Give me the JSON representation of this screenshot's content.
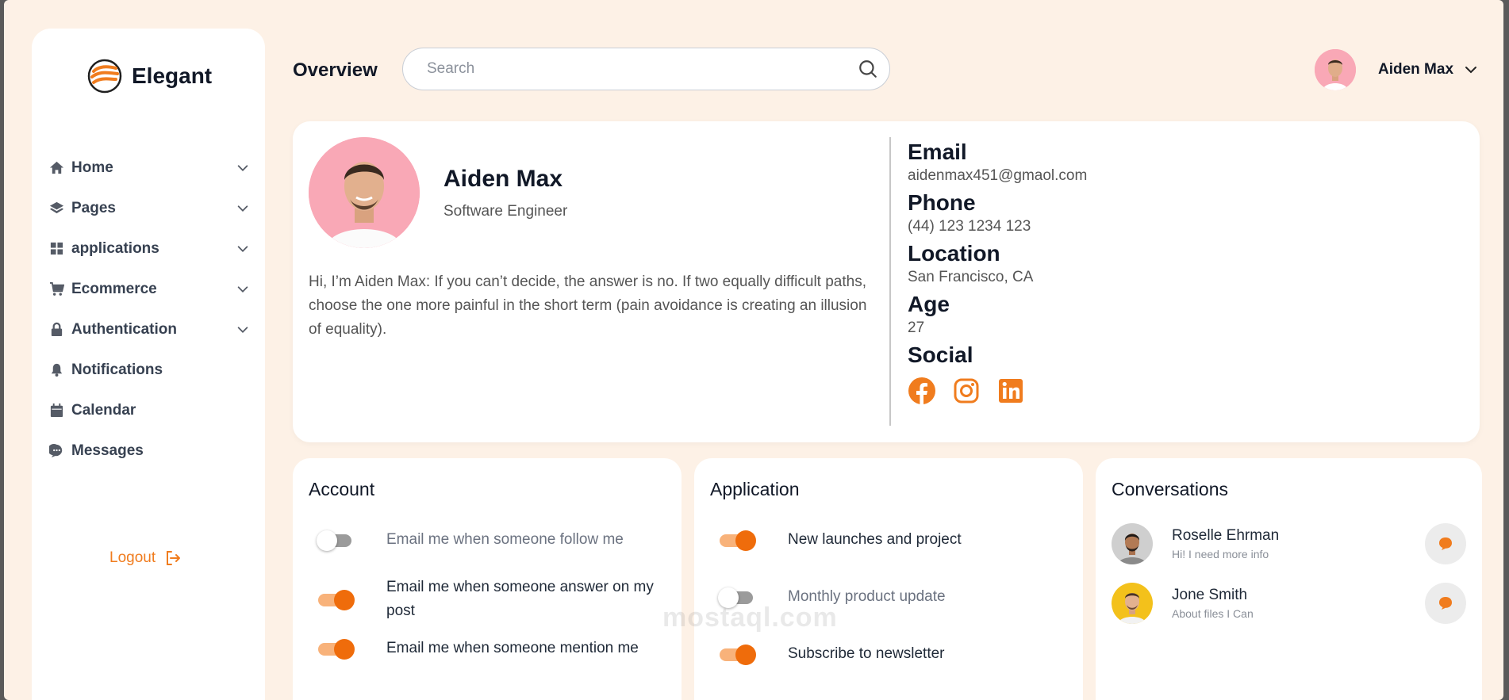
{
  "brand": {
    "name": "Elegant"
  },
  "sidebar": {
    "items": [
      {
        "label": "Home",
        "icon": "home-icon",
        "has_chevron": true
      },
      {
        "label": "Pages",
        "icon": "layers-icon",
        "has_chevron": true
      },
      {
        "label": "applications",
        "icon": "grid-icon",
        "has_chevron": true
      },
      {
        "label": "Ecommerce",
        "icon": "cart-icon",
        "has_chevron": true
      },
      {
        "label": "Authentication",
        "icon": "lock-icon",
        "has_chevron": true
      },
      {
        "label": "Notifications",
        "icon": "bell-icon",
        "has_chevron": false
      },
      {
        "label": "Calendar",
        "icon": "calendar-icon",
        "has_chevron": false
      },
      {
        "label": "Messages",
        "icon": "chat-icon",
        "has_chevron": false
      }
    ],
    "logout_label": "Logout"
  },
  "header": {
    "title": "Overview",
    "search_placeholder": "Search",
    "user_name": "Aiden Max"
  },
  "profile": {
    "name": "Aiden Max",
    "role": "Software Engineer",
    "bio": "Hi, I’m Aiden Max: If you can’t decide, the answer is no. If two equally difficult paths, choose the one more painful in the short term (pain avoidance is creating an illusion of equality).",
    "email_label": "Email",
    "email": "aidenmax451@gmaol.com",
    "phone_label": "Phone",
    "phone": "(44) 123 1234 123",
    "location_label": "Location",
    "location": "San Francisco, CA",
    "age_label": "Age",
    "age": "27",
    "social_label": "Social",
    "socials": [
      "facebook-icon",
      "instagram-icon",
      "linkedin-icon"
    ]
  },
  "account": {
    "title": "Account",
    "toggles": [
      {
        "label": "Email me when someone follow me",
        "on": false
      },
      {
        "label": "Email me when someone answer on my post",
        "on": true
      },
      {
        "label": "Email me when someone mention me",
        "on": true
      }
    ]
  },
  "application": {
    "title": "Application",
    "toggles": [
      {
        "label": "New launches and project",
        "on": true
      },
      {
        "label": "Monthly product update",
        "on": false
      },
      {
        "label": "Subscribe to newsletter",
        "on": true
      }
    ]
  },
  "conversations": {
    "title": "Conversations",
    "items": [
      {
        "name": "Roselle Ehrman",
        "message": "Hi! I need more info"
      },
      {
        "name": "Jone Smith",
        "message": "About files I Can"
      }
    ]
  },
  "watermark": "mostaql.com",
  "colors": {
    "accent": "#ef6c0b",
    "background": "#fdf1e6"
  }
}
